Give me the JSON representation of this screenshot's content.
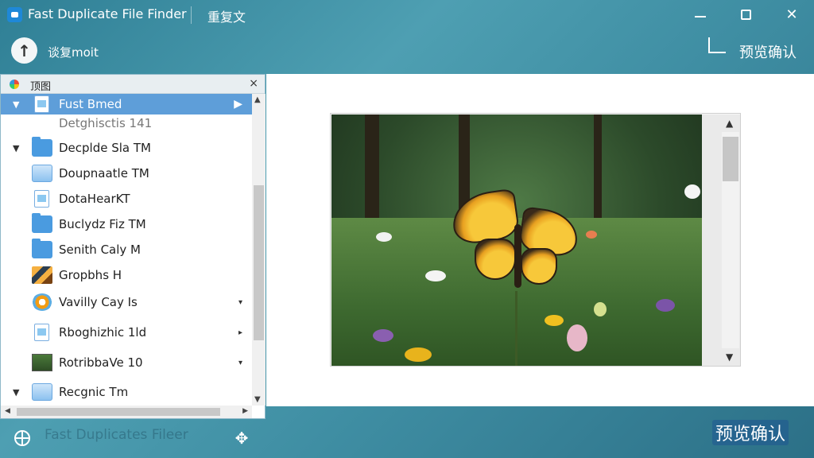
{
  "titlebar": {
    "app_title": "Fast Duplicate File Finder",
    "doc_title": "重复文",
    "minimize": "",
    "maximize": "",
    "close": "✕"
  },
  "toolbar": {
    "up_icon": "↑",
    "nav_label": "谈复moit",
    "confirm_label": "预览确认"
  },
  "left_panel": {
    "title": "顶图",
    "close": "×",
    "items": [
      {
        "label": "Fust Bmed",
        "icon": "document-icon",
        "expanded": true,
        "selected": true,
        "trail": "▶"
      },
      {
        "label": "Detghisctis 141",
        "icon": "none",
        "expanded": false,
        "selected": false,
        "trail": ""
      },
      {
        "label": "Decplde Sla TM",
        "icon": "folder-icon",
        "expanded": true,
        "selected": false,
        "trail": ""
      },
      {
        "label": "Doupnaatle TM",
        "icon": "folder-light-icon",
        "expanded": false,
        "selected": false,
        "trail": ""
      },
      {
        "label": "DotaHearKT",
        "icon": "document-icon",
        "expanded": false,
        "selected": false,
        "trail": ""
      },
      {
        "label": "Buclydz Fiz TM",
        "icon": "folder-icon",
        "expanded": false,
        "selected": false,
        "trail": ""
      },
      {
        "label": "Senith Caly M",
        "icon": "folder-icon",
        "expanded": false,
        "selected": false,
        "trail": ""
      },
      {
        "label": "Gropbhs H",
        "icon": "photo-icon",
        "expanded": false,
        "selected": false,
        "trail": ""
      },
      {
        "label": "Vavilly Cay Is",
        "icon": "gear-icon",
        "expanded": false,
        "selected": false,
        "trail": "▾"
      },
      {
        "label": "Rboghizhic 1ld",
        "icon": "document-icon",
        "expanded": false,
        "selected": false,
        "trail": "▸"
      },
      {
        "label": "RotribbaVe 10",
        "icon": "thumbnail-icon",
        "expanded": false,
        "selected": false,
        "trail": "▾"
      },
      {
        "label": "Recgnic Tm",
        "icon": "folder-light-icon",
        "expanded": true,
        "selected": false,
        "trail": ""
      }
    ]
  },
  "preview": {
    "image_subject": "butterfly-on-meadow"
  },
  "statusbar": {
    "ghost_text": "Fast Duplicates Fileer",
    "confirm_label": "预览确认"
  },
  "colors": {
    "accent": "#5e9ed9",
    "background": "#3f8ea3",
    "selection": "#5e9ed9"
  }
}
